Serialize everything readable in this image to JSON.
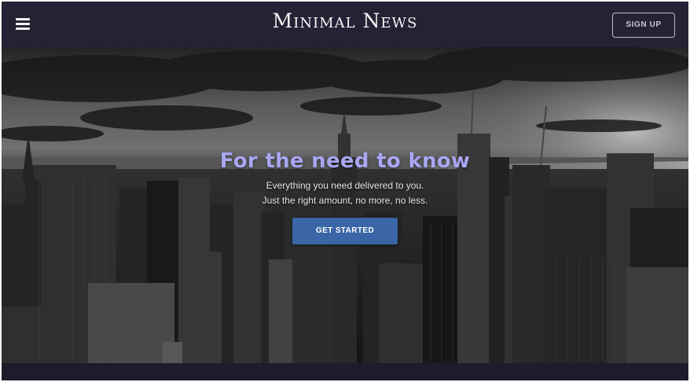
{
  "header": {
    "brand": "Minimal News",
    "signup_label": "SIGN UP",
    "menu_icon": "hamburger-menu-icon"
  },
  "hero": {
    "headline": "For the need to know",
    "subline_1": "Everything you need delivered to you.",
    "subline_2": "Just the right amount, no more, no less.",
    "cta_label": "GET STARTED",
    "background": "city-skyline-photo"
  },
  "colors": {
    "header_bg": "#242235",
    "headline": "#a9a6f2",
    "cta_bg": "#3a65a6"
  }
}
